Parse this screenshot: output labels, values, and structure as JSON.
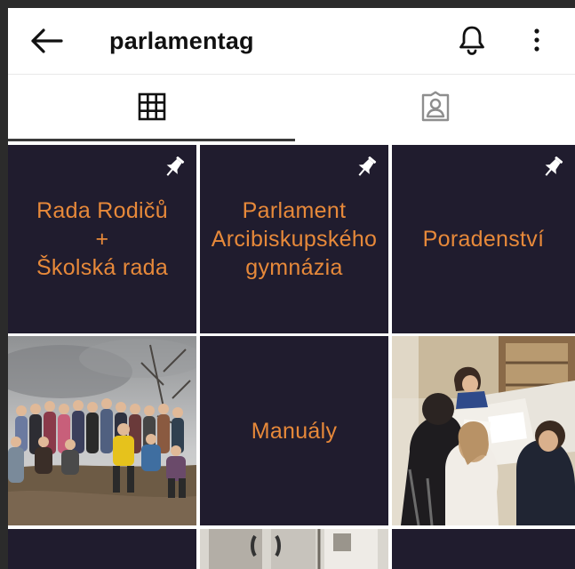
{
  "header": {
    "username": "parlamentag",
    "icons": {
      "back": "arrow-left-icon",
      "notifications": "bell-icon",
      "more": "more-vertical-icon"
    }
  },
  "tabs": [
    {
      "name": "posts",
      "icon": "grid-icon",
      "active": true
    },
    {
      "name": "tagged",
      "icon": "tagged-person-icon",
      "active": false
    }
  ],
  "posts": [
    {
      "type": "text",
      "pinned": true,
      "lines": [
        "Rada Rodičů",
        "+",
        "Školská rada"
      ]
    },
    {
      "type": "text",
      "pinned": true,
      "lines": [
        "Parlament",
        "Arcibiskupského",
        "gymnázia"
      ]
    },
    {
      "type": "text",
      "pinned": true,
      "lines": [
        "Poradenství"
      ]
    },
    {
      "type": "photo",
      "subject": "group-photo"
    },
    {
      "type": "text",
      "pinned": false,
      "lines": [
        "Manuály"
      ]
    },
    {
      "type": "photo",
      "subject": "students-at-table-photo"
    }
  ],
  "colors": {
    "tile_background": "#201c2e",
    "caption_text": "#e7893a",
    "tab_indicator": "#3a3a3a"
  }
}
